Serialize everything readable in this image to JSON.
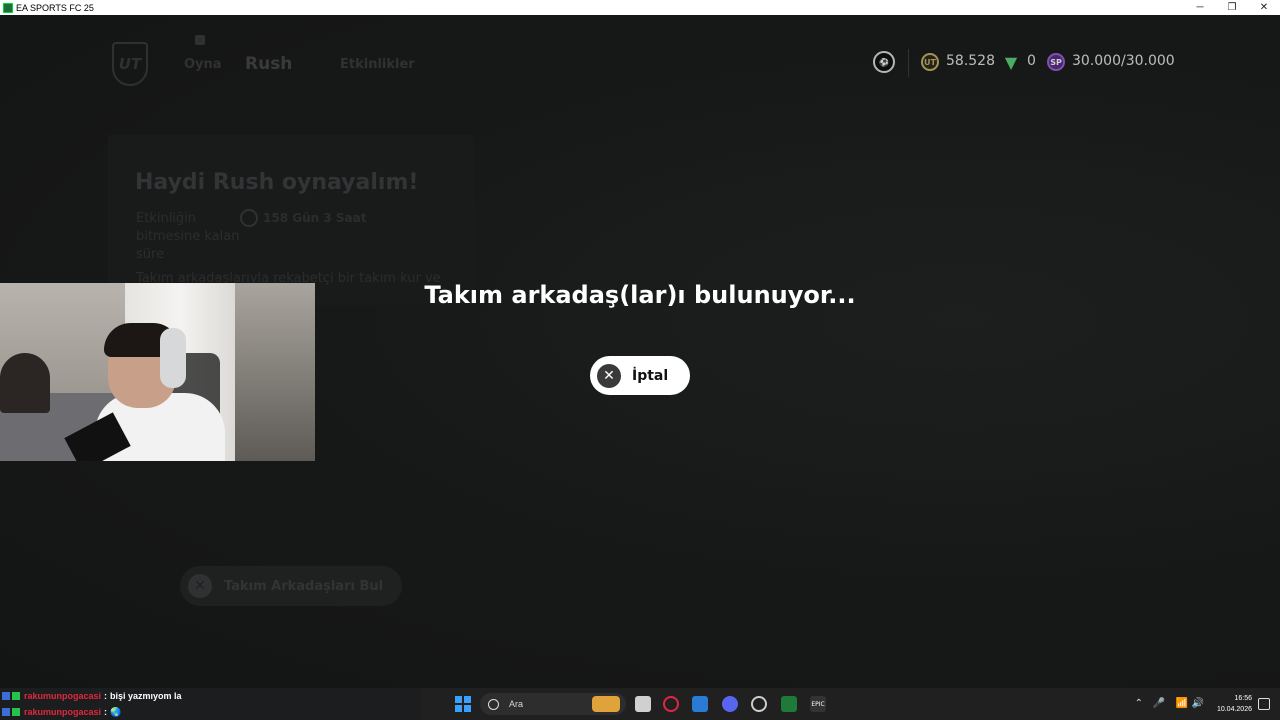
{
  "window": {
    "title": "EA SPORTS FC 25",
    "controls": [
      "─",
      "❐",
      "✕"
    ]
  },
  "nav": {
    "play": "Oyna",
    "rush": "Rush",
    "events": "Etkinlikler"
  },
  "info": {
    "title": "Haydi Rush oynayalım!",
    "remaining_label": "Etkinliğin bitmesine kalan süre",
    "remaining_value": "158 Gün 3 Saat",
    "description": "Takım arkadaşlarıyla rekabetçi bir takım kur ve"
  },
  "find_button": {
    "label": "Takım Arkadaşları Bul"
  },
  "currency": {
    "coins": "58.528",
    "points": "0",
    "sp": "30.000/30.000",
    "sp_icon": "SP",
    "coin_icon": "UT"
  },
  "matchmaking": {
    "title": "Takım arkadaş(lar)ı bulunuyor...",
    "cancel_label": "İptal"
  },
  "chat": [
    {
      "user": "rakumunpogacasi",
      "message": "bişi yazmıyom la"
    },
    {
      "user": "rakumunpogacasi",
      "message": "🌏"
    }
  ],
  "taskbar": {
    "search_placeholder": "Ara",
    "time": "16:56",
    "date": "10.04.2026",
    "epic_label": "EPIC"
  },
  "colors": {
    "accent_sp": "#9a63d6",
    "coin": "#c9b26a",
    "points": "#5bd37a",
    "chat_user": "#e0283f"
  }
}
